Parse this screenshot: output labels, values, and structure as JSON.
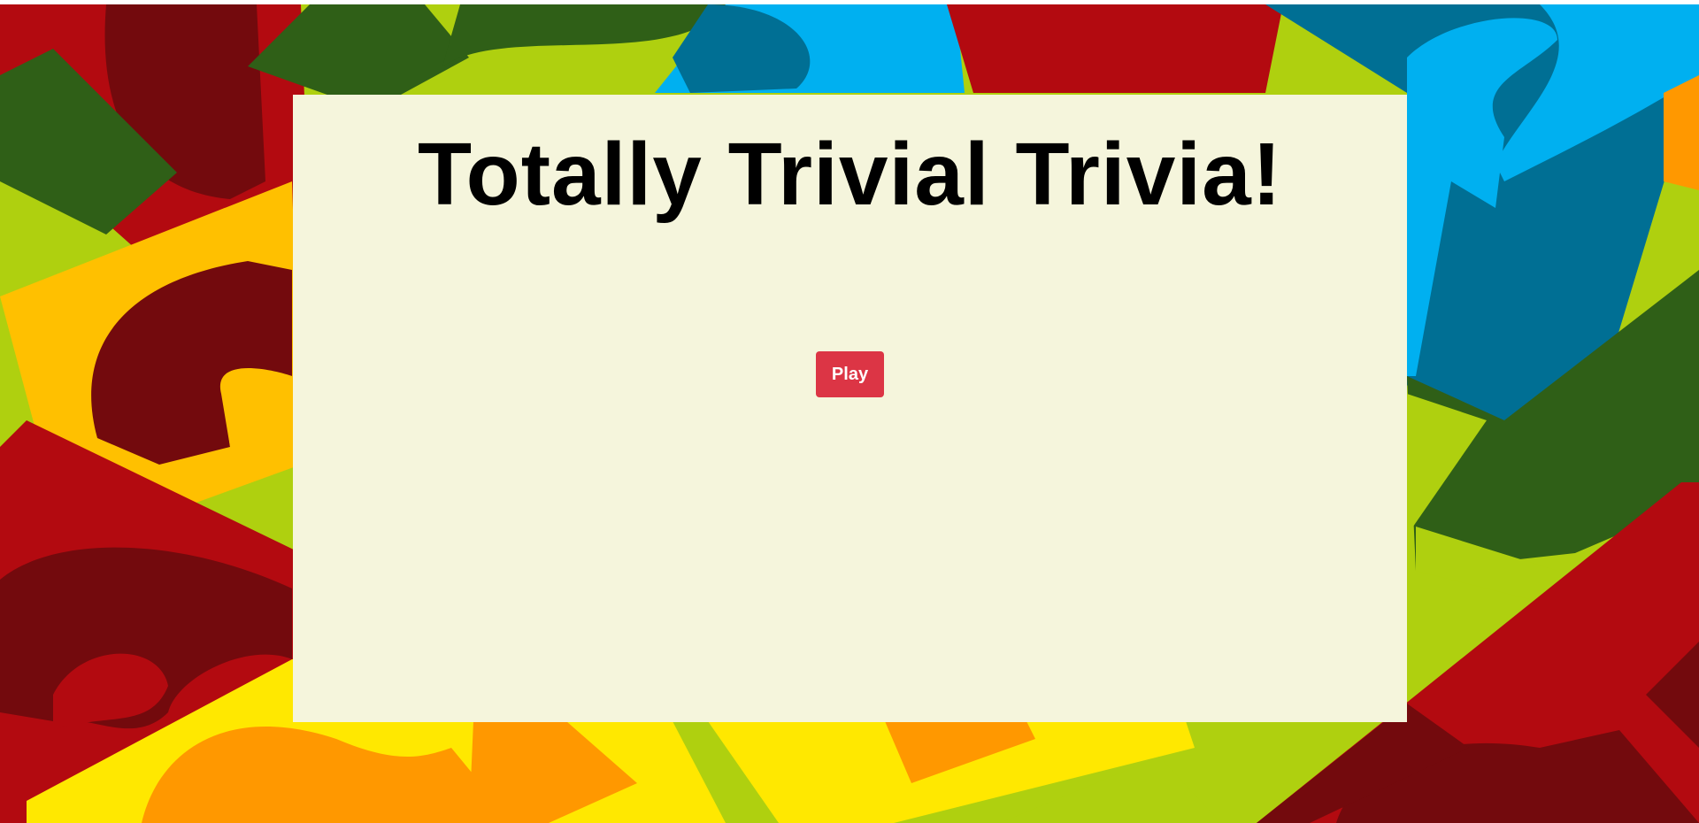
{
  "page": {
    "title": "Totally Trivial Trivia!"
  },
  "actions": {
    "play_label": "Play"
  },
  "theme": {
    "panel_bg": "#f5f5dc",
    "button_bg": "#dc3545",
    "button_text": "#ffffff",
    "background_colors": [
      "#afd00f",
      "#b30a10",
      "#730a0d",
      "#ffc000",
      "#00b0f0",
      "#006f94",
      "#2f5f17",
      "#ffe800",
      "#ff9800"
    ]
  },
  "background": {
    "description_icon": "question-mark-card-collage"
  }
}
